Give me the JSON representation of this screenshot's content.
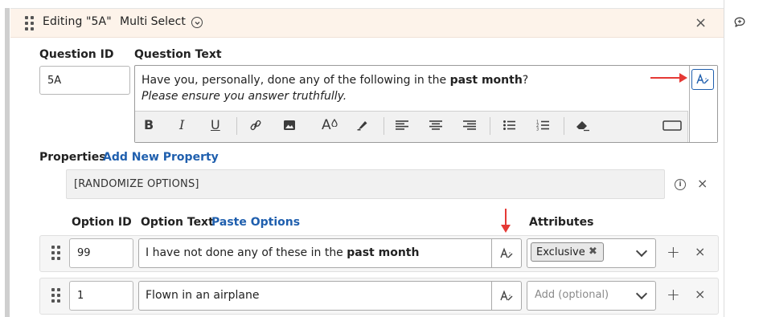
{
  "header": {
    "title": "Editing \"5A\"",
    "question_type": "Multi Select"
  },
  "question": {
    "id_label": "Question ID",
    "id_value": "5A",
    "text_label": "Question Text",
    "text_line1_before": "Have you, personally, done any of the following in the ",
    "text_line1_bold": "past month",
    "text_line1_after": "?",
    "text_line2": "Please ensure you answer truthfully."
  },
  "toolbar": {
    "bold": "B",
    "italic": "I",
    "underline": "U",
    "font_size": "A"
  },
  "properties": {
    "label": "Properties",
    "add_link": "Add New Property",
    "items": [
      "[RANDOMIZE OPTIONS]"
    ]
  },
  "options_header": {
    "option_id": "Option ID",
    "option_text": "Option Text",
    "paste_link": "Paste Options",
    "attributes": "Attributes"
  },
  "options": [
    {
      "id": "99",
      "text_before": "I have not done any of these in the ",
      "text_bold": "past month",
      "attribute_chip": "Exclusive"
    },
    {
      "id": "1",
      "text_before": "Flown in an airplane",
      "attribute_placeholder": "Add (optional)"
    }
  ],
  "colors": {
    "accent": "#1f5fae",
    "header_bg": "#fdf3ea",
    "annotation_arrow": "#e53935"
  },
  "icons": [
    "drag-handle-icon",
    "chevron-down-circle-icon",
    "close-icon",
    "comment-icon",
    "ai-rewrite-icon",
    "info-icon",
    "plus-icon",
    "chevron-down-icon"
  ]
}
